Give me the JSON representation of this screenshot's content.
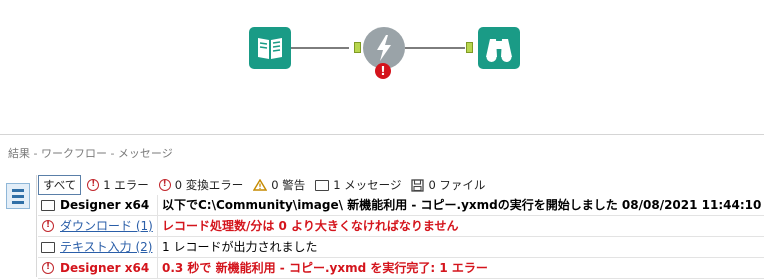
{
  "workflow": {
    "tools": [
      {
        "name": "input-tool",
        "icon": "book-icon"
      },
      {
        "name": "formula-tool",
        "icon": "lightning-icon",
        "error_badge": "!"
      },
      {
        "name": "browse-tool",
        "icon": "binoculars-icon"
      }
    ]
  },
  "results": {
    "header": "結果 - ワークフロー - メッセージ",
    "filters": {
      "all": "すべて",
      "errors": "1 エラー",
      "conversion_errors": "0 変換エラー",
      "warnings": "0 警告",
      "messages": "1 メッセージ",
      "files": "0 ファイル"
    },
    "rows": [
      {
        "icon": "message-icon",
        "source": "Designer x64",
        "message": "以下でC:\\Community\\image\\ 新機能利用 - コピー.yxmdの実行を開始しました 08/08/2021 11:44:10"
      },
      {
        "icon": "error-icon",
        "source": "ダウンロード (1)",
        "message": "レコード処理数/分は 0 より大きくなければなりません"
      },
      {
        "icon": "message-icon",
        "source": "テキスト入力 (2)",
        "message": "1 レコードが出力されました"
      },
      {
        "icon": "error-icon",
        "source": "Designer x64",
        "message": "0.3 秒で 新機能利用 - コピー.yxmd を実行完了: 1 エラー"
      }
    ]
  },
  "colors": {
    "tool_teal": "#1a9b86",
    "error_red": "#d4141c",
    "link_blue": "#2a5ea8"
  }
}
